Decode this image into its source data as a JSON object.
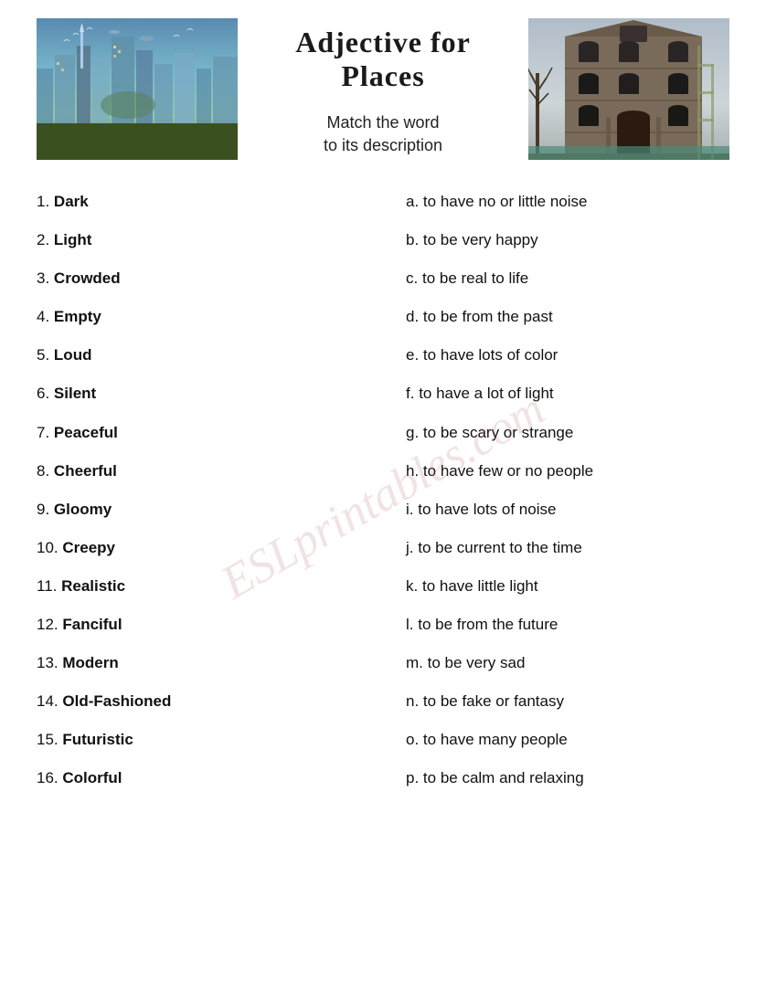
{
  "page": {
    "title": "Adjective for Places",
    "subtitle_line1": "Match the word",
    "subtitle_line2": "to its description",
    "watermark": "ESLprintables.com"
  },
  "left_items": [
    {
      "number": "1.",
      "word": "Dark"
    },
    {
      "number": "2.",
      "word": "Light"
    },
    {
      "number": "3.",
      "word": "Crowded"
    },
    {
      "number": "4.",
      "word": "Empty"
    },
    {
      "number": "5.",
      "word": "Loud"
    },
    {
      "number": "6.",
      "word": "Silent"
    },
    {
      "number": "7.",
      "word": "Peaceful"
    },
    {
      "number": "8.",
      "word": "Cheerful"
    },
    {
      "number": "9.",
      "word": "Gloomy"
    },
    {
      "number": "10.",
      "word": "Creepy"
    },
    {
      "number": "11.",
      "word": "Realistic"
    },
    {
      "number": "12.",
      "word": "Fanciful"
    },
    {
      "number": "13.",
      "word": "Modern"
    },
    {
      "number": "14.",
      "word": "Old-Fashioned"
    },
    {
      "number": "15.",
      "word": "Futuristic"
    },
    {
      "number": "16.",
      "word": "Colorful"
    }
  ],
  "right_items": [
    {
      "letter": "a.",
      "desc": "to have no or little noise"
    },
    {
      "letter": "b. ",
      "desc": "to be very happy"
    },
    {
      "letter": "c.",
      "desc": "to be real to life"
    },
    {
      "letter": "d.",
      "desc": "to be from the past"
    },
    {
      "letter": "e.",
      "desc": "to have lots of color"
    },
    {
      "letter": "f.",
      "desc": "to have a lot of light"
    },
    {
      "letter": "g.",
      "desc": "to be scary or strange"
    },
    {
      "letter": "h.",
      "desc": "to have few or no people"
    },
    {
      "letter": "i.",
      "desc": "to have lots of noise"
    },
    {
      "letter": "j.",
      "desc": "to be current to the time"
    },
    {
      "letter": "k.",
      "desc": "to have little light"
    },
    {
      "letter": "l.",
      "desc": "to be from the future"
    },
    {
      "letter": "m.",
      "desc": "to be very sad"
    },
    {
      "letter": "n.",
      "desc": "to be fake or fantasy"
    },
    {
      "letter": "o.",
      "desc": "to have many people"
    },
    {
      "letter": "p.",
      "desc": "to be calm and relaxing"
    }
  ]
}
